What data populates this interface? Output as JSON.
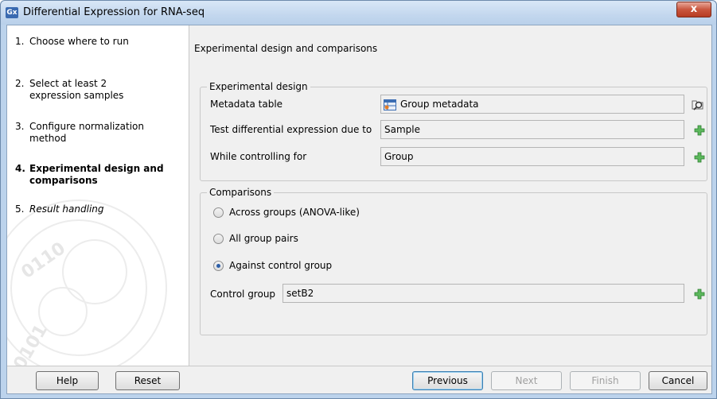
{
  "window": {
    "title": "Differential Expression for RNA-seq",
    "app_icon_label": "Gx",
    "close_label": "x"
  },
  "sidebar": {
    "steps": [
      {
        "num": "1.",
        "label": "Choose where to run"
      },
      {
        "num": "2.",
        "label": "Select at least 2 expression samples"
      },
      {
        "num": "3.",
        "label": "Configure normalization method"
      },
      {
        "num": "4.",
        "label": "Experimental design and comparisons"
      },
      {
        "num": "5.",
        "label": "Result handling"
      }
    ],
    "active_step": 4
  },
  "main": {
    "section_title": "Experimental design and comparisons",
    "experimental_design": {
      "legend": "Experimental design",
      "metadata_label": "Metadata table",
      "metadata_value": "Group metadata",
      "test_label": "Test differential expression due to",
      "test_value": "Sample",
      "control_label": "While controlling for",
      "control_value": "Group"
    },
    "comparisons": {
      "legend": "Comparisons",
      "options": [
        "Across groups (ANOVA-like)",
        "All group pairs",
        "Against control group"
      ],
      "selected_option": "Against control group",
      "control_group_label": "Control group",
      "control_group_value": "setB2"
    }
  },
  "footer": {
    "help": "Help",
    "reset": "Reset",
    "previous": "Previous",
    "next": "Next",
    "finish": "Finish",
    "cancel": "Cancel"
  },
  "colors": {
    "titlebar": "#c3d7ee",
    "close_button": "#c9563e",
    "plus_icon": "#3f9a3a",
    "radio_selected": "#2d5fa8"
  }
}
